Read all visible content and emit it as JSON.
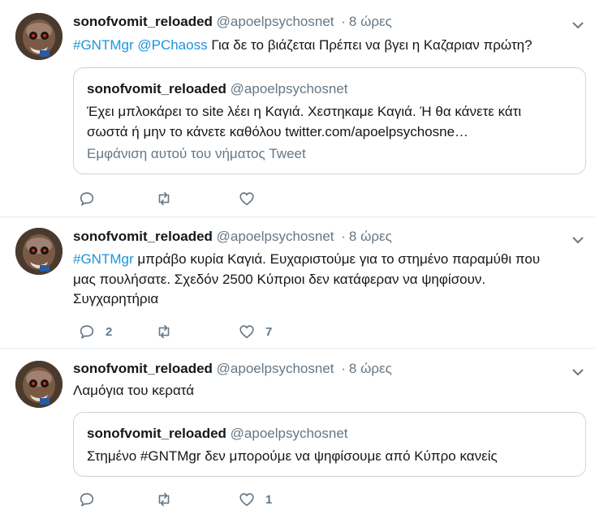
{
  "tweets": [
    {
      "name": "sonofvomit_reloaded",
      "handle": "@apoelpsychosnet",
      "dot": "·",
      "time": "8 ώρες",
      "text_parts": [
        "#GNTMgr",
        " ",
        "@PChaoss",
        "  Για δε το βιάζεται Πρέπει να βγει η Καζαριαν πρώτη?"
      ],
      "quote": {
        "name": "sonofvomit_reloaded",
        "handle": "@apoelpsychosnet",
        "line1": "Έχει μπλοκάρει το site λέει η Καγιά. Χεστηκαμε Καγιά. Ή θα κάνετε κάτι",
        "line2": "σωστά ή μην το κάνετε καθόλου twitter.com/apoelpsychosne…",
        "show_thread": "Εμφάνιση αυτού του νήματος Tweet"
      },
      "reply_count": "",
      "retweet_count": "",
      "like_count": ""
    },
    {
      "name": "sonofvomit_reloaded",
      "handle": "@apoelpsychosnet",
      "dot": "·",
      "time": "8 ώρες",
      "text_parts": [
        "#GNTMgr",
        " μπράβο κυρία Καγιά. Ευχαριστούμε για το στημένο παραμύθι που",
        "μας πουλήσατε. Σχεδόν 2500 Κύπριοι δεν κατάφεραν να ψηφίσουν.",
        "Συγχαρητήρια"
      ],
      "reply_count": "2",
      "retweet_count": "",
      "like_count": "7"
    },
    {
      "name": "sonofvomit_reloaded",
      "handle": "@apoelpsychosnet",
      "dot": "·",
      "time": "8 ώρες",
      "text_parts": [
        "Λαμόγια του κερατά"
      ],
      "quote": {
        "name": "sonofvomit_reloaded",
        "handle": "@apoelpsychosnet",
        "line1": "Στημένο #GNTMgr δεν μπορούμε να ψηφίσουμε από Κύπρο κανείς"
      },
      "reply_count": "",
      "retweet_count": "",
      "like_count": "1"
    }
  ],
  "icons": {
    "reply": "reply-icon",
    "retweet": "retweet-icon",
    "like": "like-icon",
    "caret": "chevron-down-icon"
  },
  "colors": {
    "link": "#1b95e0",
    "secondary": "#657786",
    "border": "#e6ecf0",
    "quote_border": "#ccd6dd"
  }
}
